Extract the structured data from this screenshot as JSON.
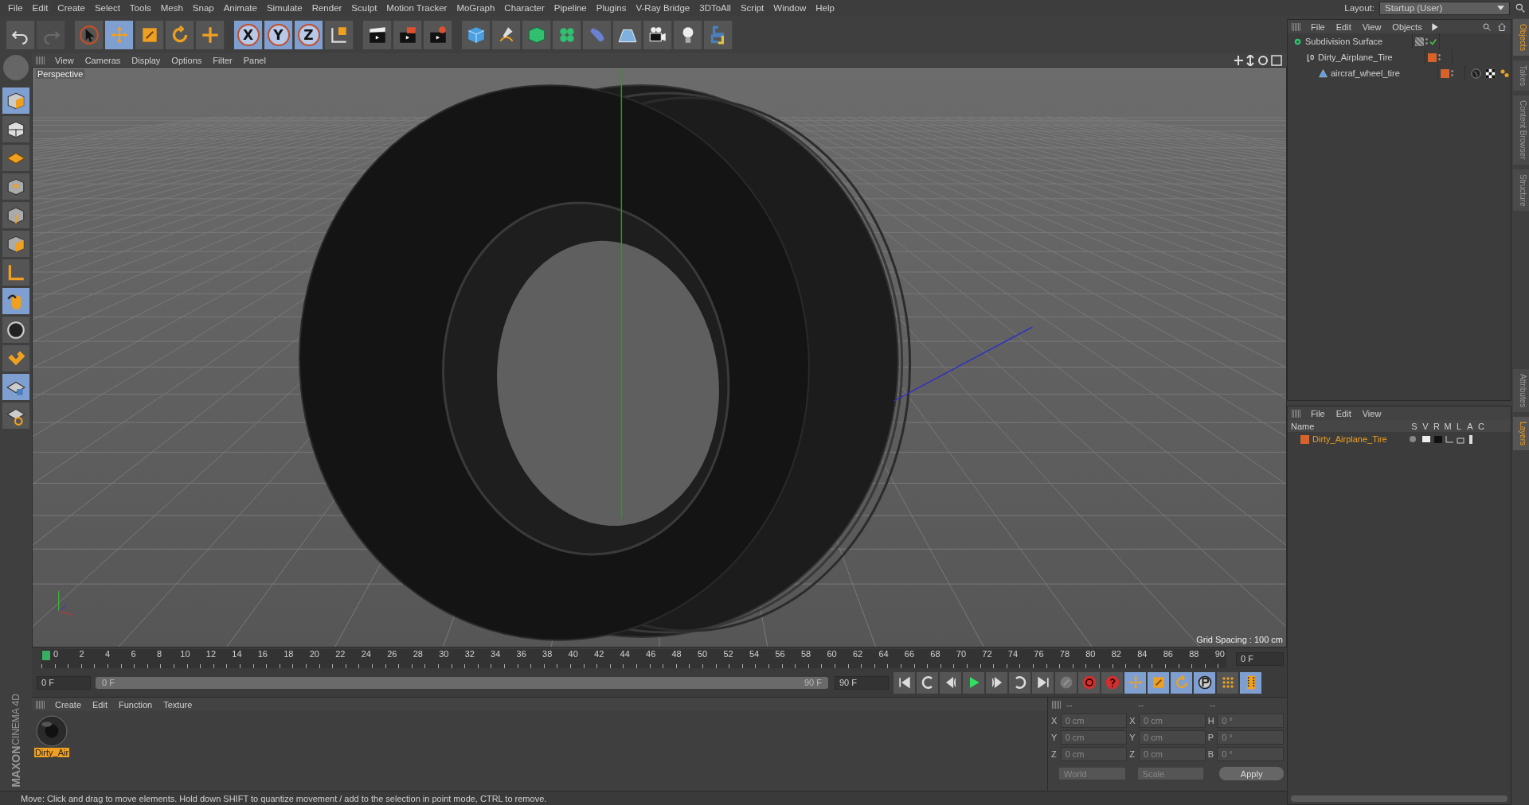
{
  "menu": [
    "File",
    "Edit",
    "Create",
    "Select",
    "Tools",
    "Mesh",
    "Snap",
    "Animate",
    "Simulate",
    "Render",
    "Sculpt",
    "Motion Tracker",
    "MoGraph",
    "Character",
    "Pipeline",
    "Plugins",
    "V-Ray Bridge",
    "3DToAll",
    "Script",
    "Window",
    "Help"
  ],
  "layout": {
    "label": "Layout:",
    "value": "Startup (User)"
  },
  "toolbar": [
    {
      "kind": "undo",
      "selected": false,
      "disabled": false
    },
    {
      "kind": "redo",
      "selected": false,
      "disabled": true
    },
    {
      "kind": "cursor",
      "selected": false,
      "disabled": false
    },
    {
      "kind": "move",
      "selected": true,
      "disabled": false
    },
    {
      "kind": "scale",
      "selected": false,
      "disabled": false
    },
    {
      "kind": "rotate",
      "selected": false,
      "disabled": false
    },
    {
      "kind": "plus",
      "selected": false,
      "disabled": false
    },
    {
      "kind": "axis",
      "label": "X",
      "selected": true,
      "disabled": false
    },
    {
      "kind": "axis",
      "label": "Y",
      "selected": true,
      "disabled": false
    },
    {
      "kind": "axis",
      "label": "Z",
      "selected": true,
      "disabled": false
    },
    {
      "kind": "coord",
      "selected": false,
      "disabled": false
    },
    {
      "kind": "clapper",
      "selected": false,
      "disabled": false
    },
    {
      "kind": "clapper-red",
      "selected": false,
      "disabled": false
    },
    {
      "kind": "clapper-gear",
      "selected": false,
      "disabled": false
    },
    {
      "kind": "cube",
      "selected": false,
      "disabled": false
    },
    {
      "kind": "pen",
      "selected": false,
      "disabled": false
    },
    {
      "kind": "subdiv",
      "selected": false,
      "disabled": false
    },
    {
      "kind": "cloner",
      "selected": false,
      "disabled": false
    },
    {
      "kind": "deformer",
      "selected": false,
      "disabled": false
    },
    {
      "kind": "floor",
      "selected": false,
      "disabled": false
    },
    {
      "kind": "camera",
      "selected": false,
      "disabled": false
    },
    {
      "kind": "light",
      "selected": false,
      "disabled": false
    },
    {
      "kind": "python",
      "selected": false,
      "disabled": false
    }
  ],
  "left_toolbar": [
    {
      "kind": "model",
      "selected": true
    },
    {
      "kind": "texture",
      "selected": false
    },
    {
      "kind": "workplane",
      "selected": false
    },
    {
      "kind": "points",
      "selected": false
    },
    {
      "kind": "edges",
      "selected": false
    },
    {
      "kind": "polygons",
      "selected": false
    },
    {
      "kind": "axis-l",
      "selected": false
    },
    {
      "kind": "mouse",
      "selected": true
    },
    {
      "kind": "s-circle",
      "selected": false
    },
    {
      "kind": "magnet",
      "selected": false
    },
    {
      "kind": "grid-lock",
      "selected": true
    },
    {
      "kind": "grid-snap",
      "selected": false
    }
  ],
  "viewport": {
    "menu": [
      "View",
      "Cameras",
      "Display",
      "Options",
      "Filter",
      "Panel"
    ],
    "camera": "Perspective",
    "grid_spacing": "Grid Spacing : 100 cm"
  },
  "object_manager": {
    "menu": [
      "File",
      "Edit",
      "View",
      "Objects"
    ],
    "objects": [
      {
        "name": "Subdivision Surface",
        "kind": "generator",
        "enabled": true,
        "children": [
          {
            "name": "Dirty_Airplane_Tire",
            "kind": "null",
            "enabled": false,
            "color": "#d8632a",
            "children": [
              {
                "name": "aircraf_wheel_tire",
                "kind": "polygon",
                "enabled": false,
                "color": "#d8632a",
                "tags": [
                  {
                    "kind": "material"
                  },
                  {
                    "kind": "checker"
                  },
                  {
                    "kind": "dots"
                  }
                ]
              }
            ]
          }
        ]
      }
    ]
  },
  "side_tabs_top": [
    {
      "label": "Objects",
      "selected": true
    },
    {
      "label": "Takes",
      "selected": false
    },
    {
      "label": "Content Browser",
      "selected": false
    },
    {
      "label": "Structure",
      "selected": false
    }
  ],
  "side_tabs_bottom": [
    {
      "label": "Attributes",
      "selected": false
    },
    {
      "label": "Layers",
      "selected": true
    }
  ],
  "layers": {
    "menu": [
      "File",
      "Edit",
      "View"
    ],
    "columns": [
      "Name",
      "S",
      "V",
      "R",
      "M",
      "L",
      "A",
      "C"
    ],
    "rows": [
      {
        "name": "Dirty_Airplane_Tire",
        "color": "#d8632a"
      }
    ]
  },
  "timeline": {
    "ticks": [
      "0",
      "2",
      "4",
      "6",
      "8",
      "10",
      "12",
      "14",
      "16",
      "18",
      "20",
      "22",
      "24",
      "26",
      "28",
      "30",
      "32",
      "34",
      "36",
      "38",
      "40",
      "42",
      "44",
      "46",
      "48",
      "50",
      "52",
      "54",
      "56",
      "58",
      "60",
      "62",
      "64",
      "66",
      "68",
      "70",
      "72",
      "74",
      "76",
      "78",
      "80",
      "82",
      "84",
      "86",
      "88",
      "90"
    ],
    "level": 0,
    "current": "0 F",
    "start": "0 F",
    "range": {
      "level": 1,
      "start": "0 F",
      "end": "90 F"
    },
    "end": "90 F"
  },
  "transport": [
    {
      "kind": "to-start",
      "selected": false
    },
    {
      "kind": "prev-key",
      "selected": false
    },
    {
      "kind": "prev-frame",
      "selected": false
    },
    {
      "kind": "play",
      "selected": false
    },
    {
      "kind": "next-frame",
      "selected": false
    },
    {
      "kind": "next-key",
      "selected": false
    },
    {
      "kind": "to-end",
      "selected": false
    },
    {
      "kind": "key-off",
      "selected": false
    },
    {
      "kind": "record",
      "selected": false
    },
    {
      "kind": "auto-key",
      "selected": false
    },
    {
      "kind": "move",
      "selected": true
    },
    {
      "kind": "scale",
      "selected": true
    },
    {
      "kind": "rotate",
      "selected": true
    },
    {
      "kind": "param",
      "selected": true
    },
    {
      "kind": "pla",
      "selected": false
    },
    {
      "kind": "film",
      "selected": true
    }
  ],
  "materials": {
    "menu": [
      "Create",
      "Edit",
      "Function",
      "Texture"
    ],
    "items": [
      {
        "name": "Dirty_Air",
        "selected": true
      }
    ]
  },
  "coordinates": {
    "headers": [
      "--",
      "--",
      "--"
    ],
    "rows": [
      [
        {
          "axis": "X",
          "value": "0 cm"
        },
        {
          "axis": "X",
          "value": "0 cm"
        },
        {
          "axis": "H",
          "value": "0 °"
        }
      ],
      [
        {
          "axis": "Y",
          "value": "0 cm"
        },
        {
          "axis": "Y",
          "value": "0 cm"
        },
        {
          "axis": "P",
          "value": "0 °"
        }
      ],
      [
        {
          "axis": "Z",
          "value": "0 cm"
        },
        {
          "axis": "Z",
          "value": "0 cm"
        },
        {
          "axis": "B",
          "value": "0 °"
        }
      ]
    ],
    "dropdowns": [
      "World",
      "Scale"
    ],
    "apply": "Apply"
  },
  "logo": {
    "brand": "MAXON",
    "product": "CINEMA 4D"
  },
  "status": "Move: Click and drag to move elements. Hold down SHIFT to quantize movement / add to the selection in point mode, CTRL to remove."
}
